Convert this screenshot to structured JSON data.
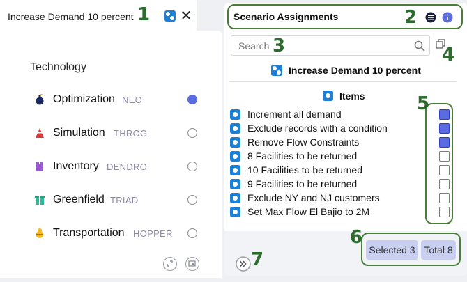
{
  "left": {
    "tab_title": "Increase Demand 10 percent",
    "heading": "Technology",
    "technologies": [
      {
        "name": "Optimization",
        "code": "NEO",
        "selected": true,
        "icon": "bomb-icon",
        "color": "#1b2a5e"
      },
      {
        "name": "Simulation",
        "code": "THROG",
        "selected": false,
        "icon": "ninja-icon",
        "color": "#d63a3a"
      },
      {
        "name": "Inventory",
        "code": "DENDRO",
        "selected": false,
        "icon": "stump-icon",
        "color": "#9b59d6"
      },
      {
        "name": "Greenfield",
        "code": "TRIAD",
        "selected": false,
        "icon": "gift-icon",
        "color": "#2fb89a"
      },
      {
        "name": "Transportation",
        "code": "HOPPER",
        "selected": false,
        "icon": "bee-icon",
        "color": "#f2b820"
      }
    ]
  },
  "right": {
    "title": "Scenario Assignments",
    "search_placeholder": "Search",
    "scenario_name": "Increase Demand 10 percent",
    "items_heading": "Items",
    "items": [
      {
        "label": "Increment all demand",
        "checked": true
      },
      {
        "label": "Exclude records with a condition",
        "checked": true
      },
      {
        "label": "Remove Flow Constraints",
        "checked": true
      },
      {
        "label": "8 Facilities to be returned",
        "checked": false
      },
      {
        "label": "10 Facilities to be returned",
        "checked": false
      },
      {
        "label": "9 Facilities to be returned",
        "checked": false
      },
      {
        "label": "Exclude NY and NJ customers",
        "checked": false
      },
      {
        "label": "Set Max Flow El Bajio to 2M",
        "checked": false
      }
    ],
    "selected_label": "Selected 3",
    "total_label": "Total 8"
  },
  "callouts": [
    "1",
    "2",
    "3",
    "4",
    "5",
    "6",
    "7"
  ],
  "colors": {
    "accent": "#5b6be0",
    "callout": "#2e6b2e",
    "item_icon": "#1e7fd6"
  }
}
